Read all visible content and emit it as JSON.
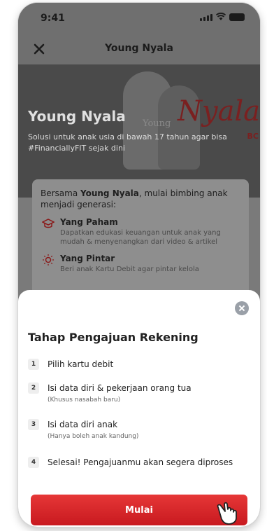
{
  "status_bar": {
    "time": "9:41"
  },
  "nav": {
    "title": "Young Nyala",
    "close_icon": "close-icon"
  },
  "hero": {
    "title": "Young Nyala",
    "subtitle": "Solusi untuk anak usia di bawah 17 tahun agar bisa #FinanciallyFIT sejak dini",
    "logo_small": "Young",
    "logo_big": "Nyala",
    "logo_color": "#7a2020",
    "brand_fragment": "BC"
  },
  "card": {
    "intro_prefix": "Bersama ",
    "intro_brand": "Young Nyala",
    "intro_suffix": ", mulai bimbing anak menjadi generasi:",
    "features": [
      {
        "icon": "graduation-cap-icon",
        "title": "Yang Paham",
        "desc": "Dapatkan edukasi keuangan untuk anak yang mudah & menyenangkan dari video & artikel"
      },
      {
        "icon": "bulb-icon",
        "title": "Yang Pintar",
        "desc": "Beri anak Kartu Debit agar pintar kelola"
      }
    ]
  },
  "sheet": {
    "title": "Tahap Pengajuan Rekening",
    "steps": [
      {
        "num": "1",
        "text": "Pilih kartu debit",
        "note": ""
      },
      {
        "num": "2",
        "text": "Isi data diri & pekerjaan orang tua",
        "note": "(Khusus nasabah baru)"
      },
      {
        "num": "3",
        "text": "Isi data diri anak",
        "note": "(Hanya boleh anak kandung)"
      },
      {
        "num": "4",
        "text": "Selesai! Pengajuanmu akan segera diproses",
        "note": ""
      }
    ],
    "button_label": "Mulai",
    "button_color": "#db2026"
  }
}
